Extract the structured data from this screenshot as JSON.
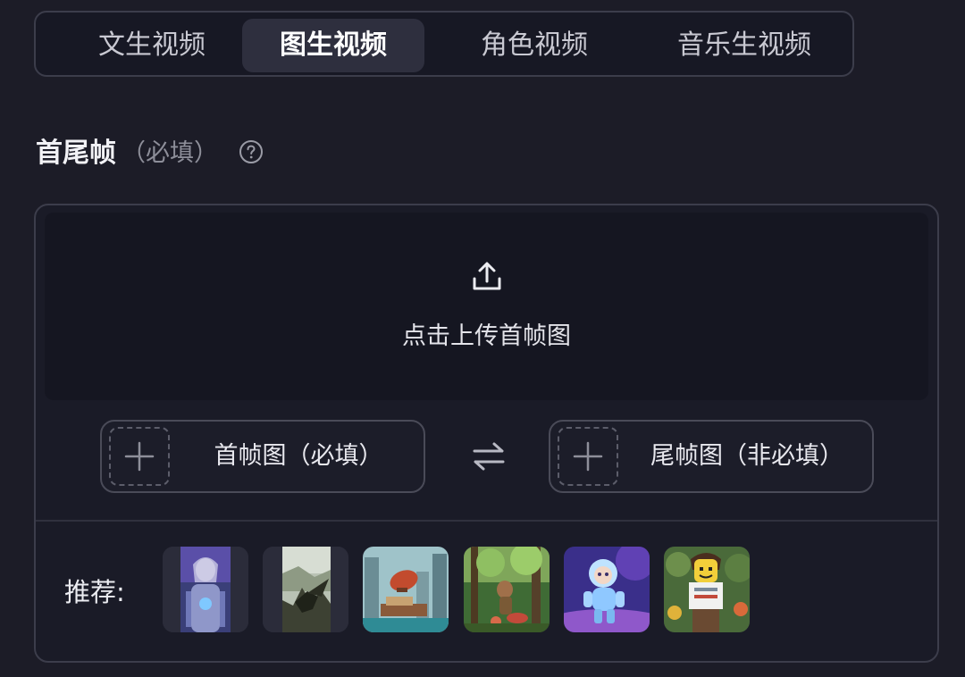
{
  "tabs": [
    {
      "label": "文生视频",
      "active": false
    },
    {
      "label": "图生视频",
      "active": true
    },
    {
      "label": "角色视频",
      "active": false
    },
    {
      "label": "音乐生视频",
      "active": false
    }
  ],
  "section": {
    "title": "首尾帧",
    "required_hint": "（必填）",
    "help_icon": "question-circle-icon"
  },
  "upload": {
    "icon": "upload-icon",
    "text": "点击上传首帧图"
  },
  "frames": {
    "first_label": "首帧图（必填）",
    "last_label": "尾帧图（非必填）",
    "swap_icon": "swap-arrows-icon"
  },
  "recommend": {
    "label": "推荐:",
    "thumbnails": [
      "cyborg-woman",
      "dragon-cliff",
      "airship-city",
      "forest-girl",
      "glass-astronaut",
      "lego-figure"
    ]
  },
  "colors": {
    "background": "#1c1c27",
    "card": "#1a1b27",
    "dropzone": "#151621",
    "border": "#3c3d4b",
    "active_tab": "#2e2f3e"
  }
}
